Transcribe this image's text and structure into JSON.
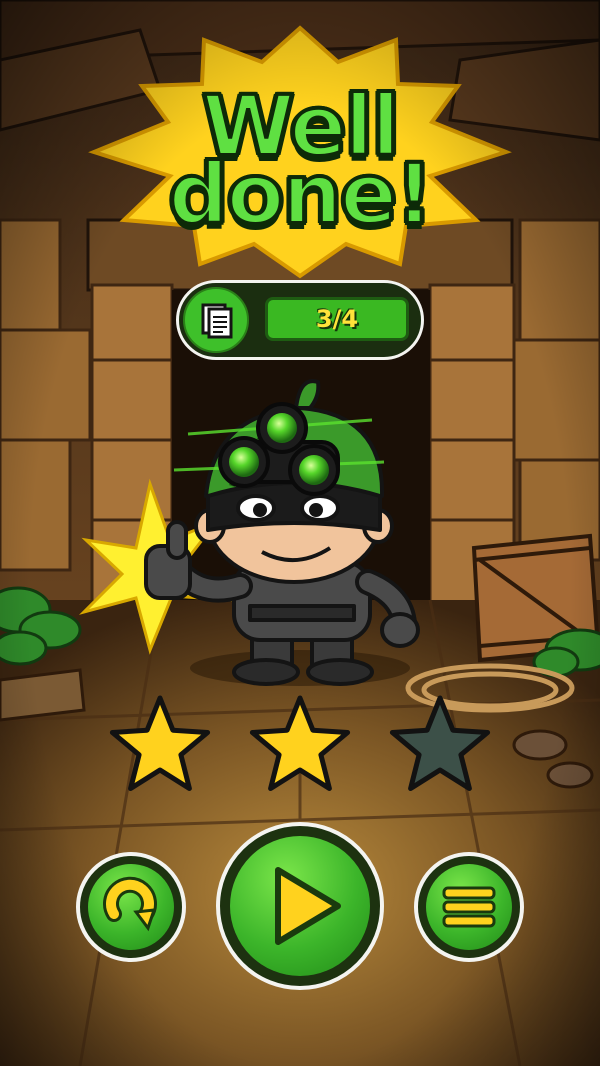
{
  "title": {
    "line1": "Well",
    "line2": "done!"
  },
  "documents": {
    "icon": "document-icon",
    "count": "3/4"
  },
  "stars": {
    "earned": 2,
    "total": 3
  },
  "buttons": {
    "restart": {
      "icon": "restart-icon"
    },
    "play": {
      "icon": "play-icon"
    },
    "menu": {
      "icon": "menu-icon"
    }
  },
  "colors": {
    "title_green": "#5fe042",
    "star_gold": "#ffd21e",
    "star_empty": "#3c5048",
    "button_green": "#3cb52a",
    "counter_text": "#ffe23a"
  }
}
